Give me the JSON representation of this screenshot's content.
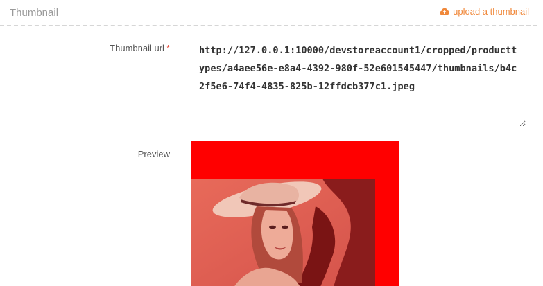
{
  "section": {
    "title": "Thumbnail",
    "upload_label": "upload a thumbnail"
  },
  "thumbnail_url": {
    "label": "Thumbnail url",
    "required_mark": "*",
    "value": "http://127.0.0.1:10000/devstoreaccount1/cropped/producttypes/a4aee56e-e8a4-4392-980f-52e601545447/thumbnails/b4c2f5e6-74f4-4835-825b-12ffdcb377c1.jpeg"
  },
  "preview": {
    "label": "Preview",
    "frame_color": "#ff0000"
  },
  "colors": {
    "accent": "#f0883a",
    "required": "#e74c3c"
  },
  "icons": {
    "upload": "cloud-upload-icon"
  }
}
